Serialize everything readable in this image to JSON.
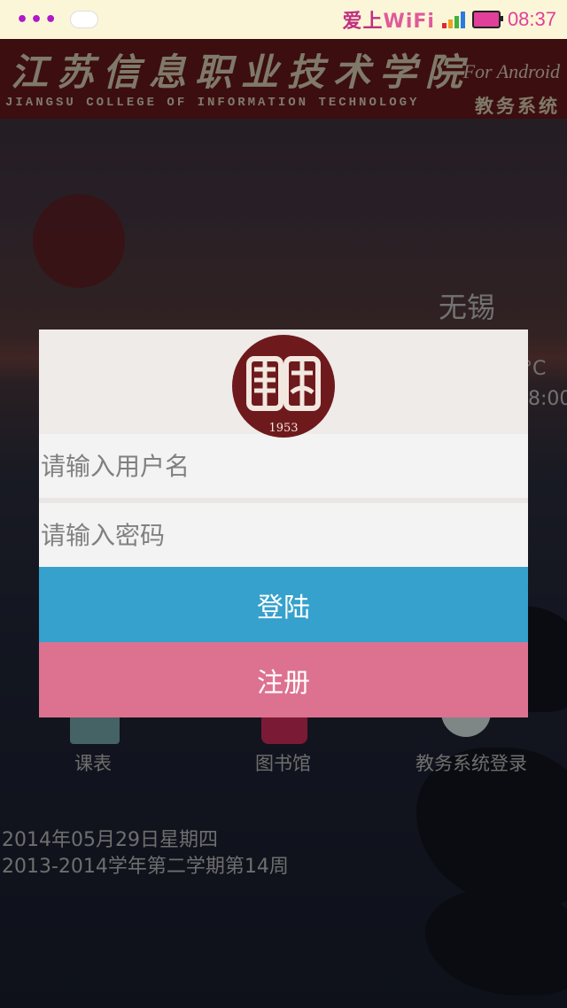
{
  "status_bar": {
    "wifi_prefix": "爱上",
    "wifi_suffix": "WiFi",
    "time": "08:37",
    "icons": [
      "menu-dots-icon",
      "cloud-icon",
      "signal-icon",
      "battery-charging-icon"
    ],
    "signal_colors": [
      "#e02a2a",
      "#f0a020",
      "#40b040",
      "#2a7ae0"
    ]
  },
  "header": {
    "title_cn": "江苏信息职业技术学院",
    "title_en": "JIANGSU COLLEGE OF INFORMATION TECHNOLOGY",
    "for_android": "For Android",
    "system_name": "教务系统"
  },
  "weather": {
    "city": "无锡",
    "temp_suffix": "°C",
    "update_time": "8:00"
  },
  "shortcuts": [
    {
      "label": "课表",
      "icon": "schedule-icon"
    },
    {
      "label": "图书馆",
      "icon": "library-icon"
    },
    {
      "label": "教务系统登录",
      "icon": "system-login-icon"
    }
  ],
  "info": {
    "date": "2014年05月29日星期四",
    "term": "2013-2014学年第二学期第14周"
  },
  "login_dialog": {
    "seal_year": "1953",
    "username_placeholder": "请输入用户名",
    "password_placeholder": "请输入密码",
    "login_label": "登陆",
    "register_label": "注册"
  },
  "colors": {
    "brand": "#6e1a1d",
    "login_button": "#35a1cc",
    "register_button": "#dd7290"
  }
}
